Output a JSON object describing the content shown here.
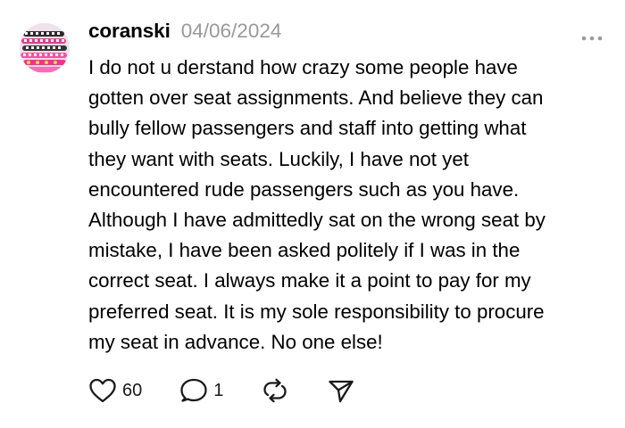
{
  "post": {
    "username": "coranski",
    "date": "04/06/2024",
    "body": "I do not u derstand how crazy some people have\ngotten over seat assignments. And believe they can\nbully fellow passengers and staff into getting what\nthey want with seats. Luckily, I have not yet\nencountered rude passengers such as you have.\nAlthough I have admittedly sat on the wrong seat by\nmistake, I have been asked politely if I was in the\ncorrect seat. I always make it a point to pay for my\npreferred seat. It is my sole responsibility to procure\nmy seat in advance. No one else!",
    "likes": "60",
    "replies": "1"
  },
  "icons": {
    "more": "more-options-icon",
    "like": "heart-icon",
    "reply": "comment-icon",
    "repost": "repost-icon",
    "share": "send-icon"
  },
  "colors": {
    "text": "#000000",
    "muted": "#999999",
    "icon": "#1a1a1a",
    "avatar_accent": "#ff2e8a"
  }
}
